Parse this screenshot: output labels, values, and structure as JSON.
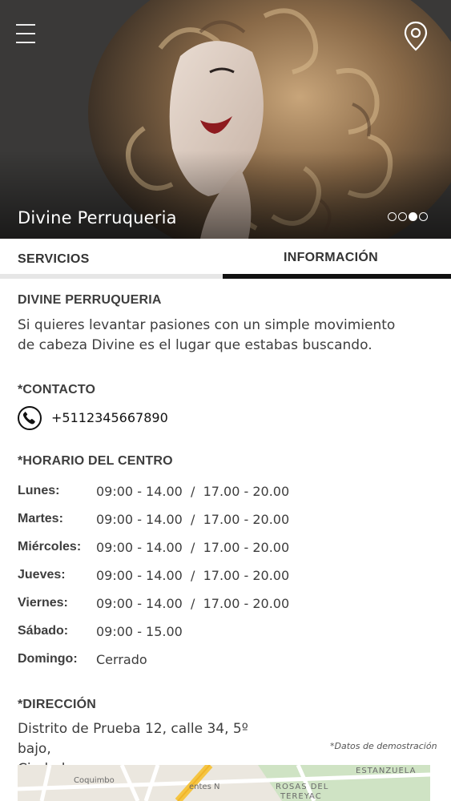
{
  "header": {
    "title": "Divine Perruqueria",
    "carousel": {
      "count": 4,
      "active": 3
    }
  },
  "tabs": [
    {
      "label": "SERVICIOS",
      "active": false
    },
    {
      "label": "INFORMACIÓN",
      "active": true
    }
  ],
  "info": {
    "name": "DIVINE PERRUQUERIA",
    "description": "Si quieres levantar pasiones con un simple movimiento de cabeza Divine es el lugar que estabas buscando."
  },
  "contact": {
    "heading": "*CONTACTO",
    "phone": "+5112345667890"
  },
  "schedule": {
    "heading": "*HORARIO DEL CENTRO",
    "rows": [
      {
        "day": "Lunes:",
        "hours": "09:00 - 14.00  /  17.00 - 20.00"
      },
      {
        "day": "Martes:",
        "hours": "09:00 - 14.00  /  17.00 - 20.00"
      },
      {
        "day": "Miércoles:",
        "hours": "09:00 - 14.00  /  17.00 - 20.00"
      },
      {
        "day": "Jueves:",
        "hours": "09:00 - 14.00  /  17.00 - 20.00"
      },
      {
        "day": "Viernes:",
        "hours": "09:00 - 14.00  /  17.00 - 20.00"
      },
      {
        "day": "Sábado:",
        "hours": "09:00 - 15.00"
      },
      {
        "day": "Domingo:",
        "hours": "Cerrado"
      }
    ]
  },
  "address": {
    "heading": "*DIRECCIÓN",
    "line1": "Distrito de Prueba 12, calle 34, 5º bajo,",
    "line2": "Ciudad",
    "demo_note": "*Datos de demostración"
  },
  "map": {
    "labels": [
      "Coquimbo",
      "ESTANZUELA",
      "ROSAS DEL",
      "TEREYAC",
      "entes N"
    ]
  },
  "colors": {
    "accent": "#111111",
    "tab_inactive_bar": "#e6e6e6"
  },
  "icons": {
    "menu": "hamburger-icon",
    "location": "map-pin-icon",
    "phone": "phone-icon"
  }
}
